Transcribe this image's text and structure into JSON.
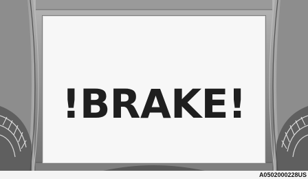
{
  "display": {
    "warning_message": "!BRAKE!",
    "text_color": "#1f1f1f",
    "screen_color": "#f7f7f7",
    "bezel_color": "#8c8c8c"
  },
  "figure": {
    "reference_code": "A0502000228US"
  },
  "decor": {
    "icons": [
      "left-gauge-icon",
      "right-gauge-icon"
    ]
  }
}
